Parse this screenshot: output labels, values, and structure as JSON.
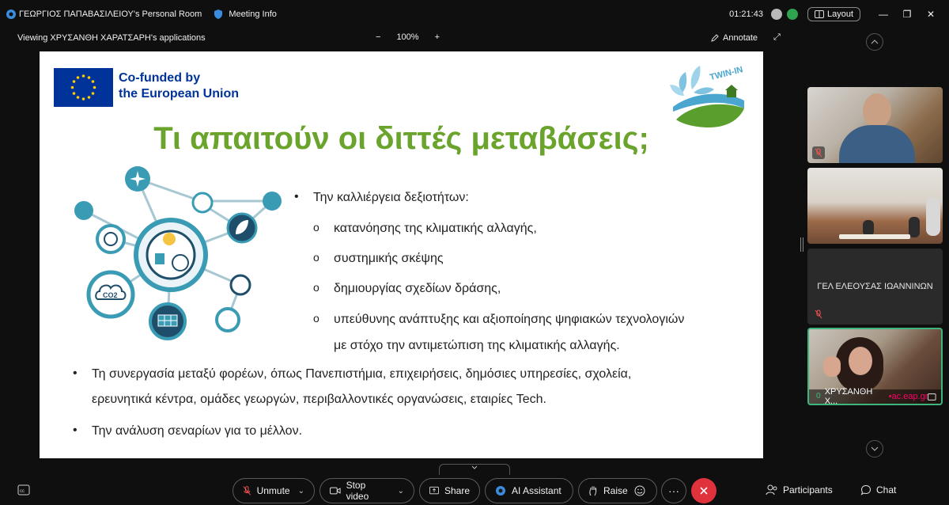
{
  "titlebar": {
    "room": "ΓΕΩΡΓΙΟΣ ΠΑΠΑΒΑΣΙΛΕΙΟΥ's Personal Room",
    "meeting_info": "Meeting Info",
    "timer": "01:21:43",
    "layout": "Layout"
  },
  "viewbar": {
    "viewing": "Viewing ΧΡΥΣΑΝΘΗ ΧΑΡΑΤΣΑΡΗ's applications",
    "zoom": "100%",
    "zoom_out": "−",
    "zoom_in": "+",
    "annotate": "Annotate"
  },
  "slide": {
    "eu_line1": "Co-funded by",
    "eu_line2": "the European Union",
    "logo_text": "TWIN-IN",
    "title": "Τι απαιτούν οι διττές μεταβάσεις;",
    "co2": "CO2",
    "bullet1": "Την καλλιέργεια δεξιοτήτων:",
    "sub1": "κατανόησης της κλιματικής αλλαγής,",
    "sub2": "συστημικής σκέψης",
    "sub3": "δημιουργίας σχεδίων δράσης,",
    "sub4_line1": "υπεύθυνης ανάπτυξης και αξιοποίησης ψηφιακών τεχνολογιών",
    "sub4_line2": "με στόχο την αντιμετώπιση της κλιματικής αλλαγής.",
    "bullet2_line1": "Τη συνεργασία μεταξύ φορέων, όπως Πανεπιστήμια, επιχειρήσεις, δημόσιες υπηρεσίες, σχολεία,",
    "bullet2_line2": "ερευνητικά κέντρα, ομάδες γεωργών, περιβαλλοντικές οργανώσεις, εταιρίες Tech.",
    "bullet3": "Την ανάλυση σεναρίων για το μέλλον."
  },
  "participants": {
    "tile3_name": "ΓΕΛ ΕΛΕΟΥΣΑΣ ΙΩΑΝΝΙΝΩΝ",
    "tile4_name": "ΧΡΥΣΑΝΘΗ Χ...",
    "tile4_domain": "•ac.eap.gr"
  },
  "toolbar": {
    "unmute": "Unmute",
    "stop_video": "Stop video",
    "share": "Share",
    "ai_assistant": "AI Assistant",
    "raise": "Raise",
    "more": "···",
    "participants": "Participants",
    "chat": "Chat"
  },
  "colors": {
    "title_green": "#6aa42c",
    "eu_blue": "#003399",
    "end_red": "#e0323c",
    "diagram_teal": "#3a9bb5",
    "active_speaker": "#3fb57e"
  }
}
